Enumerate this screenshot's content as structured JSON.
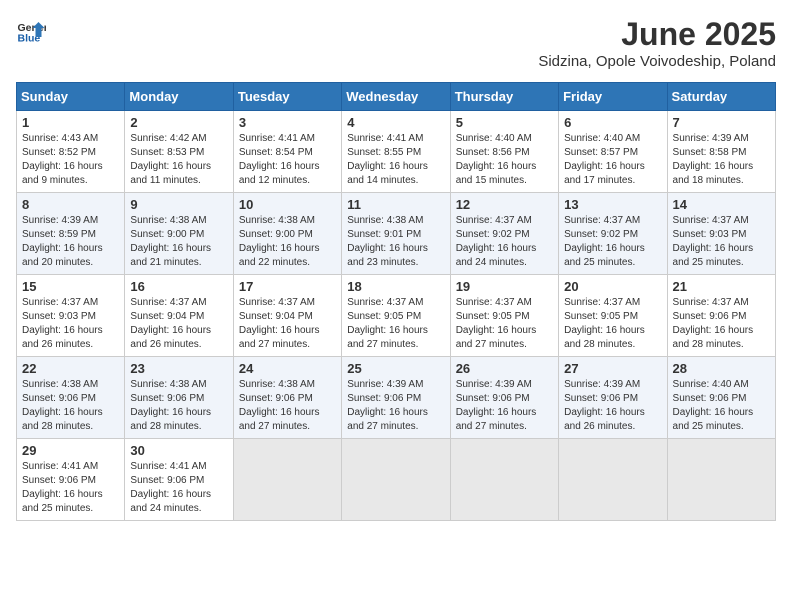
{
  "header": {
    "logo_general": "General",
    "logo_blue": "Blue",
    "title": "June 2025",
    "subtitle": "Sidzina, Opole Voivodeship, Poland"
  },
  "calendar": {
    "days_of_week": [
      "Sunday",
      "Monday",
      "Tuesday",
      "Wednesday",
      "Thursday",
      "Friday",
      "Saturday"
    ],
    "weeks": [
      [
        {
          "day": "1",
          "info": "Sunrise: 4:43 AM\nSunset: 8:52 PM\nDaylight: 16 hours\nand 9 minutes."
        },
        {
          "day": "2",
          "info": "Sunrise: 4:42 AM\nSunset: 8:53 PM\nDaylight: 16 hours\nand 11 minutes."
        },
        {
          "day": "3",
          "info": "Sunrise: 4:41 AM\nSunset: 8:54 PM\nDaylight: 16 hours\nand 12 minutes."
        },
        {
          "day": "4",
          "info": "Sunrise: 4:41 AM\nSunset: 8:55 PM\nDaylight: 16 hours\nand 14 minutes."
        },
        {
          "day": "5",
          "info": "Sunrise: 4:40 AM\nSunset: 8:56 PM\nDaylight: 16 hours\nand 15 minutes."
        },
        {
          "day": "6",
          "info": "Sunrise: 4:40 AM\nSunset: 8:57 PM\nDaylight: 16 hours\nand 17 minutes."
        },
        {
          "day": "7",
          "info": "Sunrise: 4:39 AM\nSunset: 8:58 PM\nDaylight: 16 hours\nand 18 minutes."
        }
      ],
      [
        {
          "day": "8",
          "info": "Sunrise: 4:39 AM\nSunset: 8:59 PM\nDaylight: 16 hours\nand 20 minutes."
        },
        {
          "day": "9",
          "info": "Sunrise: 4:38 AM\nSunset: 9:00 PM\nDaylight: 16 hours\nand 21 minutes."
        },
        {
          "day": "10",
          "info": "Sunrise: 4:38 AM\nSunset: 9:00 PM\nDaylight: 16 hours\nand 22 minutes."
        },
        {
          "day": "11",
          "info": "Sunrise: 4:38 AM\nSunset: 9:01 PM\nDaylight: 16 hours\nand 23 minutes."
        },
        {
          "day": "12",
          "info": "Sunrise: 4:37 AM\nSunset: 9:02 PM\nDaylight: 16 hours\nand 24 minutes."
        },
        {
          "day": "13",
          "info": "Sunrise: 4:37 AM\nSunset: 9:02 PM\nDaylight: 16 hours\nand 25 minutes."
        },
        {
          "day": "14",
          "info": "Sunrise: 4:37 AM\nSunset: 9:03 PM\nDaylight: 16 hours\nand 25 minutes."
        }
      ],
      [
        {
          "day": "15",
          "info": "Sunrise: 4:37 AM\nSunset: 9:03 PM\nDaylight: 16 hours\nand 26 minutes."
        },
        {
          "day": "16",
          "info": "Sunrise: 4:37 AM\nSunset: 9:04 PM\nDaylight: 16 hours\nand 26 minutes."
        },
        {
          "day": "17",
          "info": "Sunrise: 4:37 AM\nSunset: 9:04 PM\nDaylight: 16 hours\nand 27 minutes."
        },
        {
          "day": "18",
          "info": "Sunrise: 4:37 AM\nSunset: 9:05 PM\nDaylight: 16 hours\nand 27 minutes."
        },
        {
          "day": "19",
          "info": "Sunrise: 4:37 AM\nSunset: 9:05 PM\nDaylight: 16 hours\nand 27 minutes."
        },
        {
          "day": "20",
          "info": "Sunrise: 4:37 AM\nSunset: 9:05 PM\nDaylight: 16 hours\nand 28 minutes."
        },
        {
          "day": "21",
          "info": "Sunrise: 4:37 AM\nSunset: 9:06 PM\nDaylight: 16 hours\nand 28 minutes."
        }
      ],
      [
        {
          "day": "22",
          "info": "Sunrise: 4:38 AM\nSunset: 9:06 PM\nDaylight: 16 hours\nand 28 minutes."
        },
        {
          "day": "23",
          "info": "Sunrise: 4:38 AM\nSunset: 9:06 PM\nDaylight: 16 hours\nand 28 minutes."
        },
        {
          "day": "24",
          "info": "Sunrise: 4:38 AM\nSunset: 9:06 PM\nDaylight: 16 hours\nand 27 minutes."
        },
        {
          "day": "25",
          "info": "Sunrise: 4:39 AM\nSunset: 9:06 PM\nDaylight: 16 hours\nand 27 minutes."
        },
        {
          "day": "26",
          "info": "Sunrise: 4:39 AM\nSunset: 9:06 PM\nDaylight: 16 hours\nand 27 minutes."
        },
        {
          "day": "27",
          "info": "Sunrise: 4:39 AM\nSunset: 9:06 PM\nDaylight: 16 hours\nand 26 minutes."
        },
        {
          "day": "28",
          "info": "Sunrise: 4:40 AM\nSunset: 9:06 PM\nDaylight: 16 hours\nand 25 minutes."
        }
      ],
      [
        {
          "day": "29",
          "info": "Sunrise: 4:41 AM\nSunset: 9:06 PM\nDaylight: 16 hours\nand 25 minutes."
        },
        {
          "day": "30",
          "info": "Sunrise: 4:41 AM\nSunset: 9:06 PM\nDaylight: 16 hours\nand 24 minutes."
        },
        {
          "day": "",
          "info": ""
        },
        {
          "day": "",
          "info": ""
        },
        {
          "day": "",
          "info": ""
        },
        {
          "day": "",
          "info": ""
        },
        {
          "day": "",
          "info": ""
        }
      ]
    ]
  }
}
